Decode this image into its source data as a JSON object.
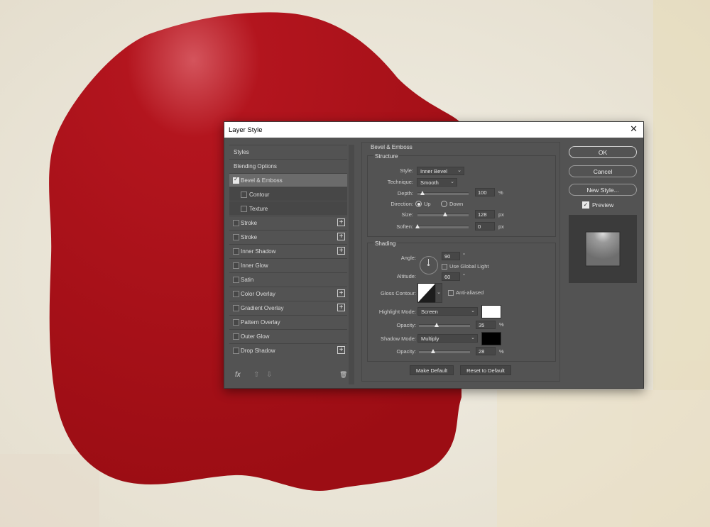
{
  "dialog": {
    "title": "Layer Style"
  },
  "left_panel": {
    "styles_label": "Styles",
    "blending_label": "Blending Options",
    "items": [
      {
        "label": "Bevel & Emboss",
        "checked": true,
        "selected": true,
        "plus": false
      },
      {
        "label": "Contour",
        "checked": false,
        "sub": true
      },
      {
        "label": "Texture",
        "checked": false,
        "sub": true
      },
      {
        "label": "Stroke",
        "checked": false,
        "plus": true
      },
      {
        "label": "Stroke",
        "checked": false,
        "plus": true
      },
      {
        "label": "Inner Shadow",
        "checked": false,
        "plus": true
      },
      {
        "label": "Inner Glow",
        "checked": false,
        "plus": false
      },
      {
        "label": "Satin",
        "checked": false,
        "plus": false
      },
      {
        "label": "Color Overlay",
        "checked": false,
        "plus": true
      },
      {
        "label": "Gradient Overlay",
        "checked": false,
        "plus": true
      },
      {
        "label": "Pattern Overlay",
        "checked": false,
        "plus": false
      },
      {
        "label": "Outer Glow",
        "checked": false,
        "plus": false
      },
      {
        "label": "Drop Shadow",
        "checked": false,
        "plus": true
      }
    ],
    "plus_glyph": "+",
    "footer": {
      "fx": "fx",
      "up": "⇧",
      "down": "⇩",
      "trash": "🗑"
    }
  },
  "bevel": {
    "section_title": "Bevel & Emboss",
    "structure": {
      "title": "Structure",
      "style_label": "Style:",
      "style_value": "Inner Bevel",
      "technique_label": "Technique:",
      "technique_value": "Smooth",
      "depth_label": "Depth:",
      "depth_value": "100",
      "depth_unit": "%",
      "depth_level": 0.1,
      "direction_label": "Direction:",
      "dir_up": "Up",
      "dir_down": "Down",
      "size_label": "Size:",
      "size_value": "128",
      "size_unit": "px",
      "size_level": 0.55,
      "soften_label": "Soften:",
      "soften_value": "0",
      "soften_unit": "px",
      "soften_level": 0.0
    },
    "shading": {
      "title": "Shading",
      "angle_label": "Angle:",
      "angle_value": "90",
      "angle_unit": "°",
      "global_light_label": "Use Global Light",
      "altitude_label": "Altitude:",
      "altitude_value": "60",
      "altitude_unit": "°",
      "gloss_label": "Gloss Contour:",
      "anti_aliased_label": "Anti-aliased",
      "highlight_label": "Highlight Mode:",
      "highlight_value": "Screen",
      "highlight_color": "#ffffff",
      "hl_opacity_label": "Opacity:",
      "hl_opacity_value": "35",
      "hl_opacity_unit": "%",
      "hl_opacity_level": 0.35,
      "shadow_label": "Shadow Mode:",
      "shadow_value": "Multiply",
      "shadow_color": "#000000",
      "sh_opacity_label": "Opacity:",
      "sh_opacity_value": "28",
      "sh_opacity_unit": "%",
      "sh_opacity_level": 0.28
    },
    "make_default": "Make Default",
    "reset_default": "Reset to Default"
  },
  "right_panel": {
    "ok": "OK",
    "cancel": "Cancel",
    "new_style": "New Style...",
    "preview_label": "Preview"
  },
  "colors": {
    "seal": "#a50f16",
    "dialog_bg": "#535353"
  }
}
